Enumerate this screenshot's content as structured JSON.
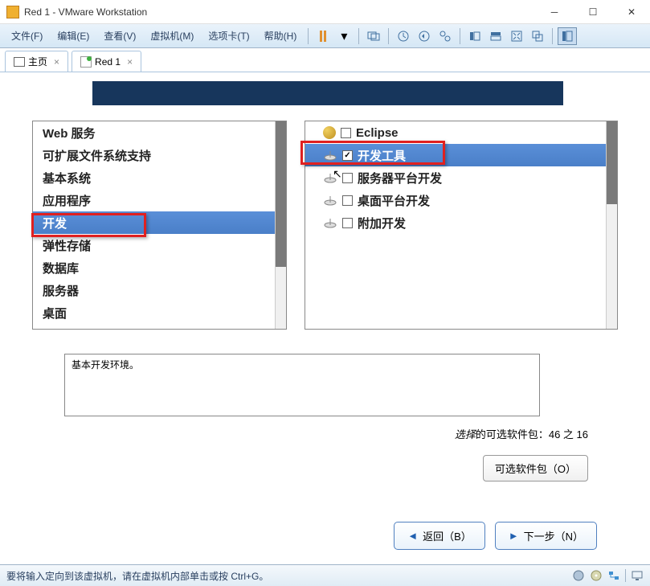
{
  "titlebar": {
    "title": "Red 1 - VMware Workstation"
  },
  "menubar": {
    "file": "文件(F)",
    "edit": "编辑(E)",
    "view": "查看(V)",
    "vm": "虚拟机(M)",
    "tabs": "选项卡(T)",
    "help": "帮助(H)"
  },
  "tabs": {
    "home": "主页",
    "vm": "Red 1"
  },
  "categories": [
    "Web 服务",
    "可扩展文件系统支持",
    "基本系统",
    "应用程序",
    "开发",
    "弹性存储",
    "数据库",
    "服务器",
    "桌面"
  ],
  "packages": [
    "Eclipse",
    "开发工具",
    "服务器平台开发",
    "桌面平台开发",
    "附加开发"
  ],
  "description": "基本开发环境。",
  "status": {
    "prefix": "选择",
    "mid": "的可选软件包：",
    "count": "46 之 16"
  },
  "buttons": {
    "optional": "可选软件包（O）",
    "back": "返回（B）",
    "next": "下一步（N）"
  },
  "statusbar": {
    "text": "要将输入定向到该虚拟机，请在虚拟机内部单击或按 Ctrl+G。"
  }
}
